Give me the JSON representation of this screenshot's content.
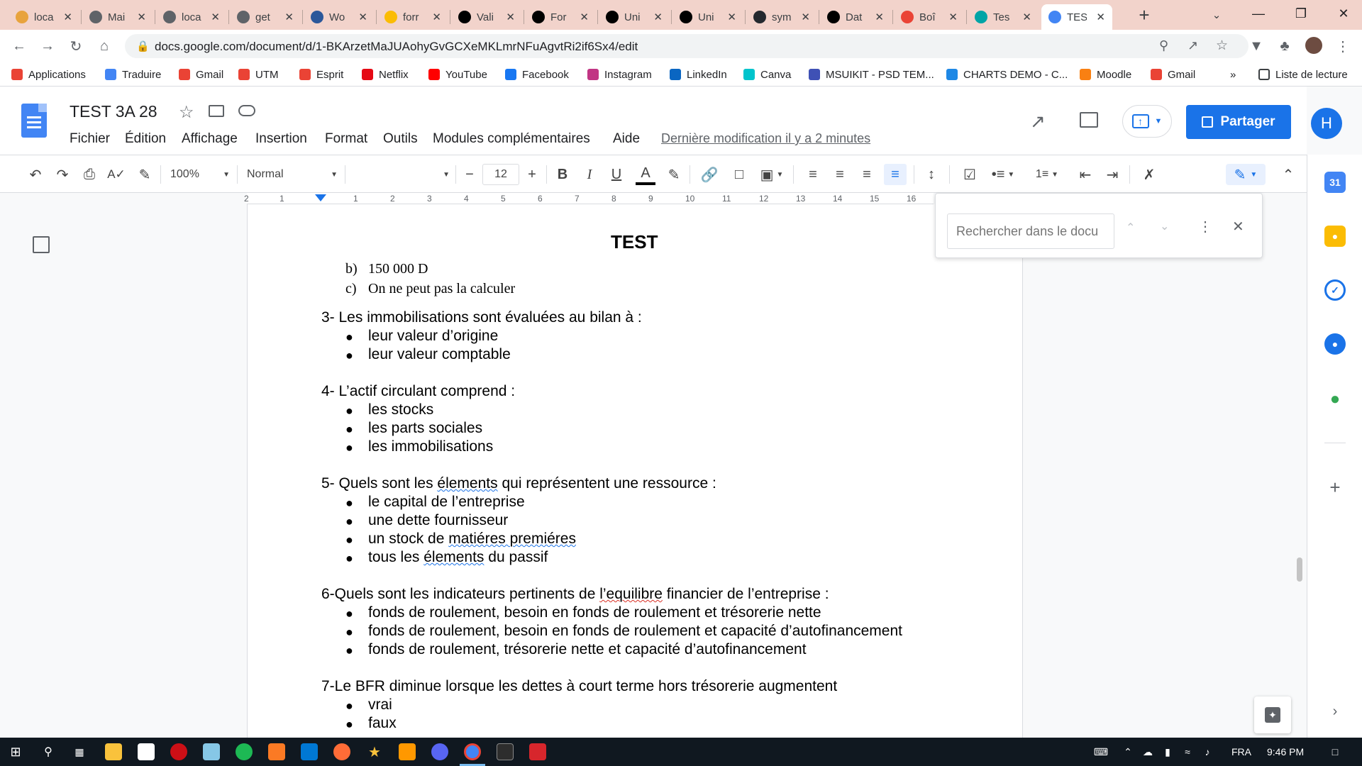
{
  "browser": {
    "tabs": [
      {
        "label": "loca",
        "color": "#e8a33d"
      },
      {
        "label": "Mai",
        "color": "#5f6368"
      },
      {
        "label": "loca",
        "color": "#5f6368"
      },
      {
        "label": "get",
        "color": "#5f6368"
      },
      {
        "label": "Wo",
        "color": "#2b579a"
      },
      {
        "label": "forr",
        "color": "#fbbc04"
      },
      {
        "label": "Vali",
        "color": "#000000"
      },
      {
        "label": "For",
        "color": "#000000"
      },
      {
        "label": "Uni",
        "color": "#000000"
      },
      {
        "label": "Uni",
        "color": "#000000"
      },
      {
        "label": "sym",
        "color": "#24292f"
      },
      {
        "label": "Dat",
        "color": "#000000"
      },
      {
        "label": "Boî",
        "color": "#ea4335"
      },
      {
        "label": "Tes",
        "color": "#00a4a6"
      },
      {
        "label": "TES",
        "color": "#4285f4",
        "active": true
      }
    ],
    "url": "docs.google.com/document/d/1-BKArzetMaJUAohyGvGCXeMKLmrNFuAgvtRi2if6Sx4/edit",
    "bookmarks": [
      {
        "label": "Applications",
        "color": "#ea4335"
      },
      {
        "label": "Traduire",
        "color": "#4285f4"
      },
      {
        "label": "Gmail",
        "color": "#ea4335"
      },
      {
        "label": "UTM",
        "color": "#ea4335"
      },
      {
        "label": "Esprit",
        "color": "#ea4335"
      },
      {
        "label": "Netflix",
        "color": "#e50914"
      },
      {
        "label": "YouTube",
        "color": "#ff0000"
      },
      {
        "label": "Facebook",
        "color": "#1877f2"
      },
      {
        "label": "Instagram",
        "color": "#c13584"
      },
      {
        "label": "LinkedIn",
        "color": "#0a66c2"
      },
      {
        "label": "Canva",
        "color": "#00c4cc"
      },
      {
        "label": "MSUIKIT - PSD TEM...",
        "color": "#3f51b5"
      },
      {
        "label": "CHARTS DEMO - C...",
        "color": "#1e88e5"
      },
      {
        "label": "Moodle",
        "color": "#f98012"
      },
      {
        "label": "Gmail",
        "color": "#ea4335"
      }
    ],
    "more_bookmarks": "»",
    "reading_list": "Liste de lecture"
  },
  "docs": {
    "title": "TEST 3A 28",
    "menus": [
      "Fichier",
      "Édition",
      "Affichage",
      "Insertion",
      "Format",
      "Outils",
      "Modules complémentaires",
      "Aide"
    ],
    "last_modified": "Dernière modification il y a 2 minutes",
    "share_label": "Partager",
    "avatar_initial": "H",
    "toolbar": {
      "zoom": "100%",
      "style": "Normal",
      "font": "",
      "font_size": "12"
    },
    "ruler_numbers": [
      "2",
      "1",
      "1",
      "2",
      "3",
      "4",
      "5",
      "6",
      "7",
      "8",
      "9",
      "10",
      "11",
      "12",
      "13",
      "14",
      "15",
      "16"
    ],
    "find_placeholder": "Rechercher dans le docu"
  },
  "document": {
    "heading": "TEST",
    "q2_tail": [
      {
        "marker": "b)",
        "text": "150 000 D"
      },
      {
        "marker": "c)",
        "text": "On ne peut pas la calculer"
      }
    ],
    "q3": {
      "question": "3- Les immobilisations sont évaluées au bilan à :",
      "options": [
        "leur valeur d’origine",
        "leur valeur comptable"
      ]
    },
    "q4": {
      "question": "4- L’actif circulant comprend :",
      "options": [
        "les stocks",
        "les parts sociales",
        "les immobilisations"
      ]
    },
    "q5": {
      "q_pre": "5- Quels sont les ",
      "q_spell": "élements",
      "q_post": " qui représentent une ressource :",
      "opt1": "le capital de l’entreprise",
      "opt2": "une dette fournisseur",
      "opt3_pre": "un stock de ",
      "opt3_spell": "matiéres premiéres",
      "opt4_pre": "tous les ",
      "opt4_spell": "élements",
      "opt4_post": " du passif"
    },
    "q6": {
      "q_pre": "6-Quels sont les indicateurs pertinents de ",
      "q_spell": "l’equilibre",
      "q_post": " financier de l’entreprise :",
      "options": [
        "fonds de roulement, besoin en fonds de roulement et trésorerie nette",
        "fonds de roulement, besoin en fonds de roulement et capacité d’autofinancement",
        "fonds de roulement, trésorerie nette et capacité d’autofinancement"
      ]
    },
    "q7": {
      "question": "7-Le BFR diminue lorsque les dettes à court terme hors trésorerie augmentent",
      "options": [
        "vrai",
        "faux"
      ]
    },
    "bullet_char": "●"
  },
  "taskbar": {
    "language": "FRA",
    "time": "9:46 PM"
  }
}
